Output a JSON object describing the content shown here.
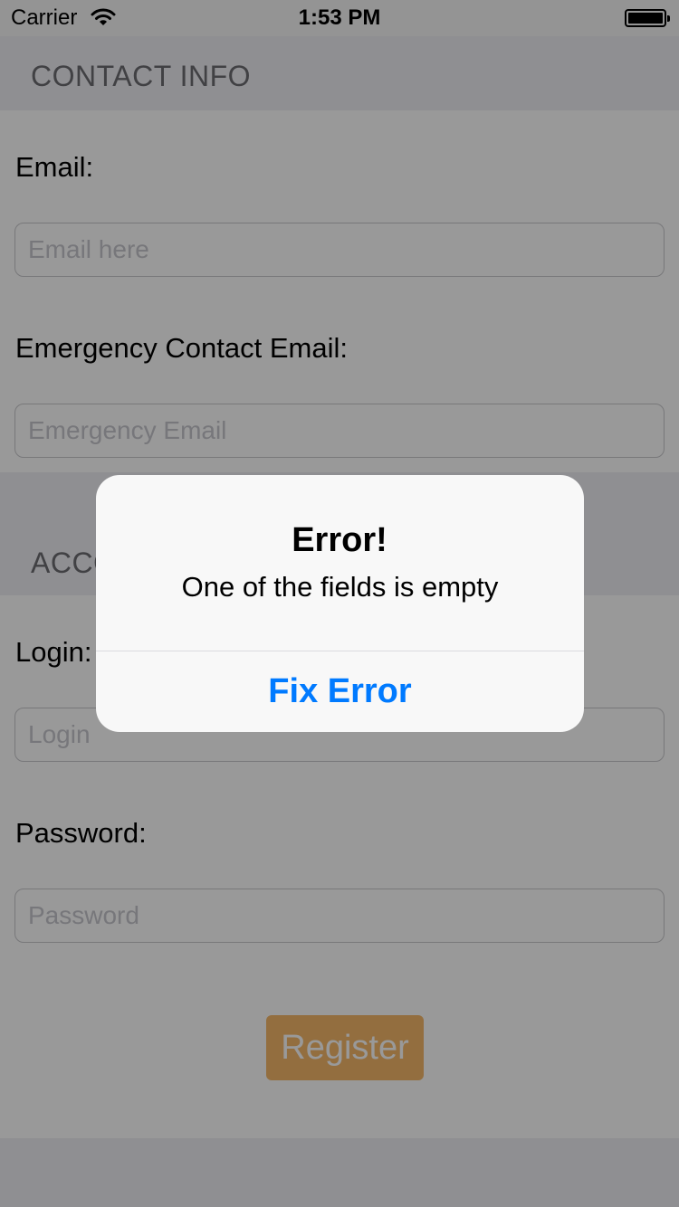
{
  "status_bar": {
    "carrier": "Carrier",
    "time": "1:53 PM",
    "wifi_icon": "wifi-icon",
    "battery_icon": "battery-icon"
  },
  "contact_section": {
    "header": "CONTACT INFO",
    "email_label": "Email:",
    "email_placeholder": "Email here",
    "email_value": "",
    "emergency_label": "Emergency Contact Email:",
    "emergency_placeholder": "Emergency Email",
    "emergency_value": ""
  },
  "account_section": {
    "header": "ACCO",
    "login_label": "Login:",
    "login_placeholder": "Login",
    "login_value": "",
    "password_label": "Password:",
    "password_placeholder": "Password",
    "password_value": ""
  },
  "register_label": "Register",
  "alert": {
    "title": "Error!",
    "message": "One of the fields is empty",
    "button_label": "Fix Error"
  },
  "colors": {
    "accent_blue": "#007aff",
    "register_button": "#f5b869",
    "section_background": "#efeff4"
  }
}
